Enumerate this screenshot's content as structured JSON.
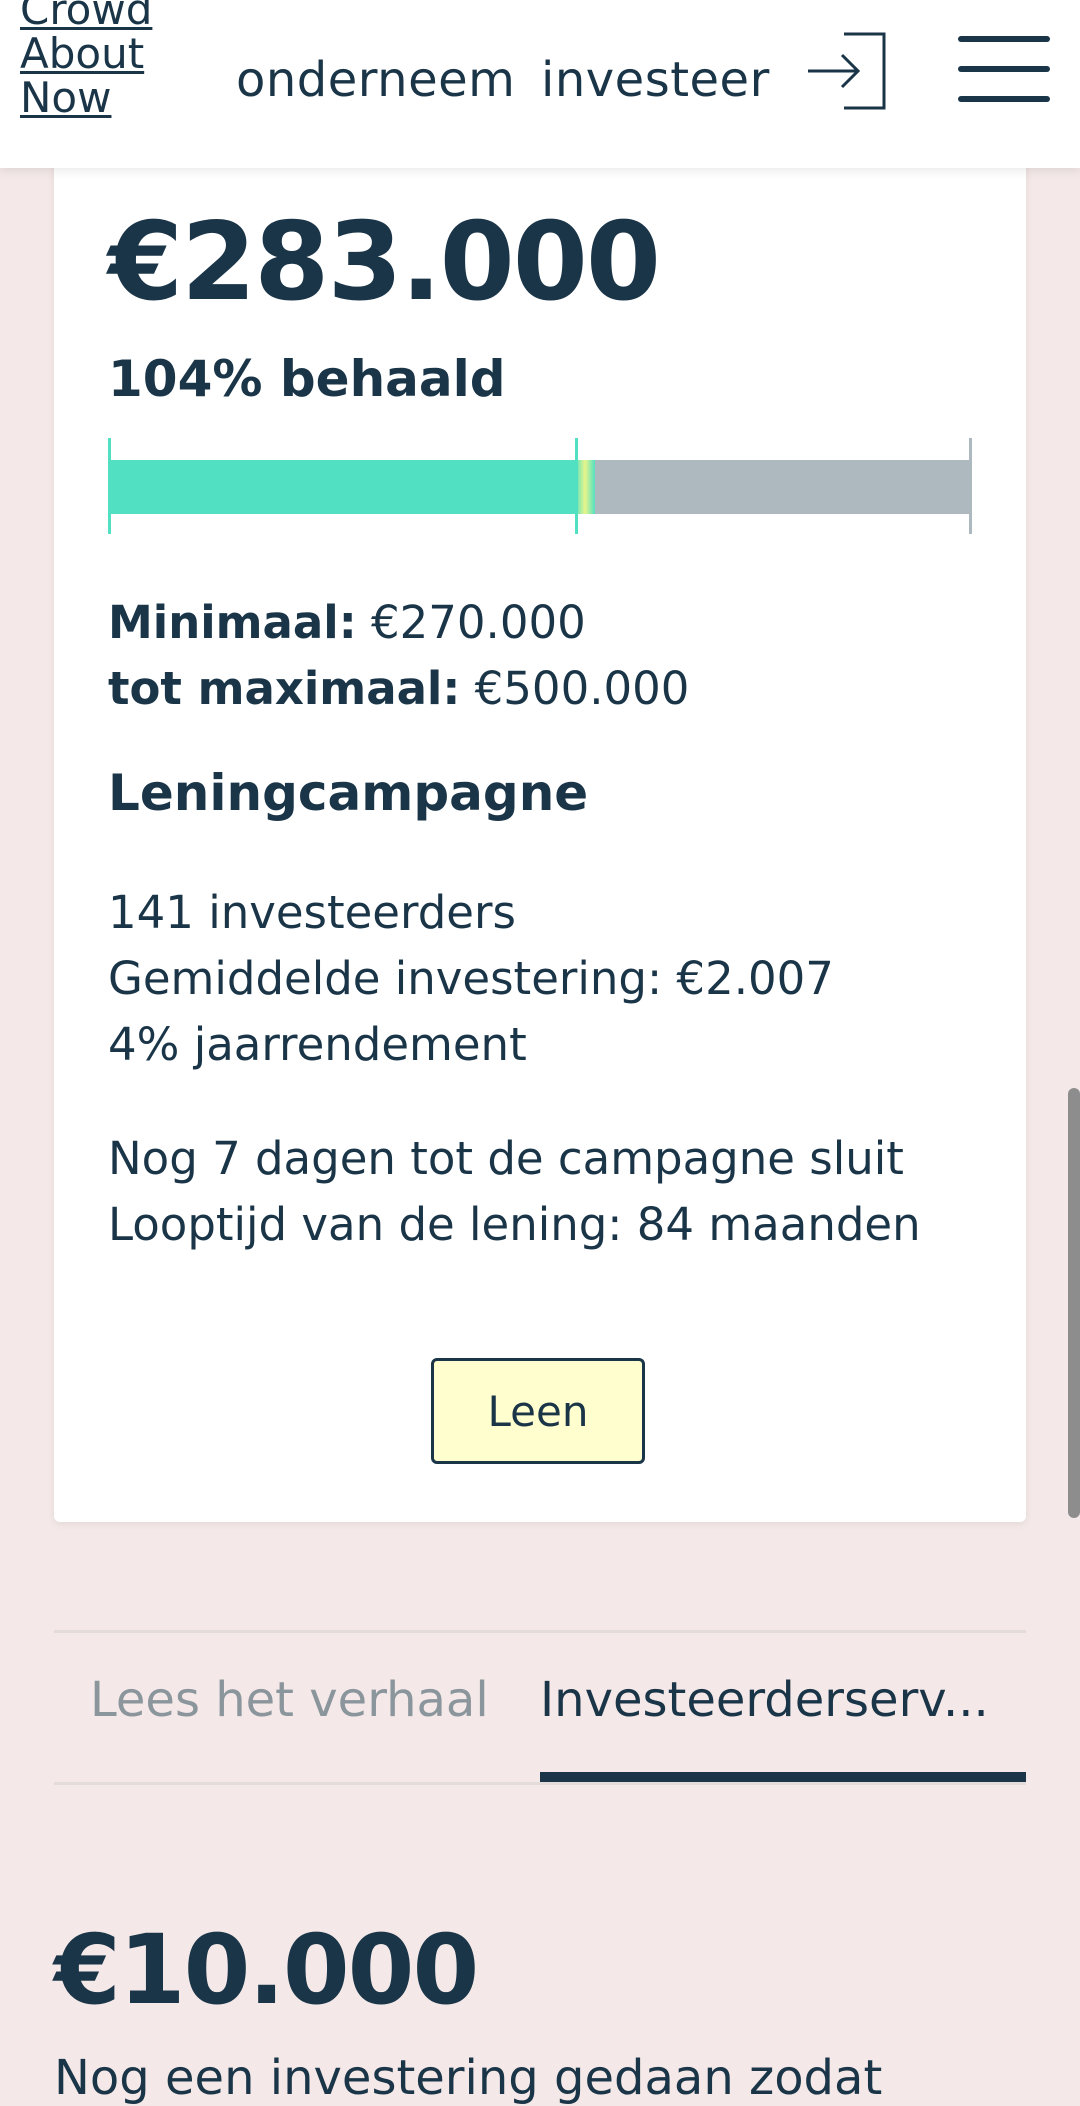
{
  "header": {
    "logo_lines": [
      "Crowd",
      "About",
      "Now"
    ],
    "nav": [
      "onderneem",
      "investeer"
    ]
  },
  "campaign": {
    "amount": "€283.000",
    "achieved": "104% behaald",
    "progress_fraction": 0.54,
    "min_label": "Minimaal:",
    "min_value": "€270.000",
    "max_label": "tot maximaal:",
    "max_value": "€500.000",
    "type_title": "Leningcampagne",
    "stats": [
      "141 investeerders",
      "Gemiddelde investering: €2.007",
      "4% jaarrendement"
    ],
    "timing": [
      "Nog 7 dagen tot de campagne sluit",
      "Looptijd van de lening: 84 maanden"
    ],
    "button_label": "Leen"
  },
  "tabs": [
    "Lees het verhaal",
    "Investeerderserv..."
  ],
  "investor_section": {
    "amount": "€10.000",
    "partial_text": "Nog een investering gedaan zodat"
  },
  "colors": {
    "primary": "#1b3548",
    "progress_fill": "#52e0c3",
    "progress_track": "#aeb9bf",
    "button_bg": "#fffecf",
    "page_bg": "#f4e9e8"
  }
}
